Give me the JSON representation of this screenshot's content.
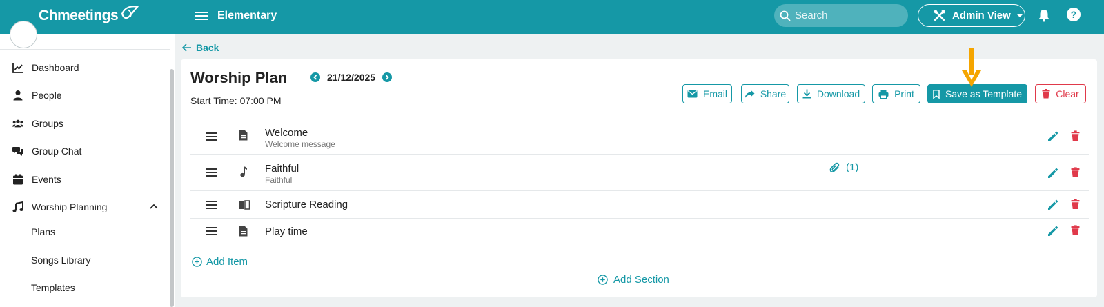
{
  "header": {
    "brand": "Chmeetings",
    "org": "Elementary",
    "search_placeholder": "Search",
    "admin_label": "Admin View"
  },
  "sidebar": {
    "items": [
      {
        "label": "Dashboard",
        "icon": "chart-line-icon"
      },
      {
        "label": "People",
        "icon": "person-icon"
      },
      {
        "label": "Groups",
        "icon": "users-icon"
      },
      {
        "label": "Group Chat",
        "icon": "chat-icon"
      },
      {
        "label": "Events",
        "icon": "calendar-icon"
      },
      {
        "label": "Worship Planning",
        "icon": "music-icon"
      }
    ],
    "subitems": [
      "Plans",
      "Songs Library",
      "Templates"
    ]
  },
  "main": {
    "back_label": "Back",
    "title": "Worship Plan",
    "date": "21/12/2025",
    "start_time": "Start Time: 07:00 PM",
    "actions": {
      "email": "Email",
      "share": "Share",
      "download": "Download",
      "print": "Print",
      "save_template": "Save as Template",
      "clear": "Clear"
    },
    "items": [
      {
        "name": "Welcome",
        "sub": "Welcome message",
        "icon": "document-icon"
      },
      {
        "name": "Faithful",
        "sub": "Faithful",
        "icon": "music-note-icon",
        "attachments": "(1)"
      },
      {
        "name": "Scripture Reading",
        "sub": "",
        "icon": "book-icon"
      },
      {
        "name": "Play time",
        "sub": "",
        "icon": "document-icon"
      }
    ],
    "add_item": "Add Item",
    "add_section": "Add Section"
  },
  "colors": {
    "brand": "#1598a6",
    "danger": "#e0394a",
    "annotation_arrow": "#f5a500"
  }
}
